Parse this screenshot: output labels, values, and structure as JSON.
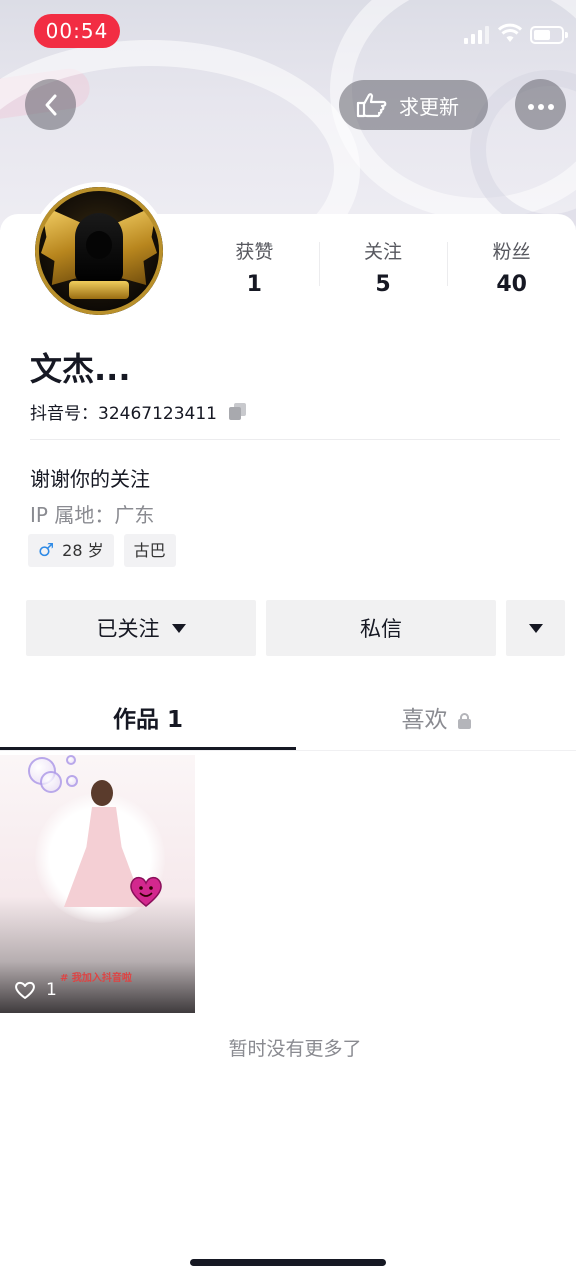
{
  "status_bar": {
    "time": "00:54"
  },
  "nav": {
    "update_button_label": "求更新"
  },
  "profile": {
    "name": "文杰...",
    "douyin_id": "抖音号：32467123411",
    "bio": "谢谢你的关注",
    "ip_location": "IP 属地：广东",
    "tags": {
      "age": "28 岁",
      "location": "古巴"
    }
  },
  "stats": [
    {
      "label": "获赞",
      "value": "1"
    },
    {
      "label": "关注",
      "value": "5"
    },
    {
      "label": "粉丝",
      "value": "40"
    }
  ],
  "actions": {
    "follow_label": "已关注",
    "message_label": "私信"
  },
  "tabs": [
    {
      "label": "作品 1",
      "active": true
    },
    {
      "label": "喜欢",
      "active": false,
      "locked": true
    }
  ],
  "videos": [
    {
      "likes": "1",
      "hashtag": "# 我加入抖音啦"
    }
  ],
  "footer": {
    "no_more_text": "暂时没有更多了"
  },
  "icons": {
    "back": "chevron-left-icon",
    "update": "hand-point-icon",
    "more": "ellipsis-icon",
    "copy": "copy-icon",
    "lock": "lock-icon",
    "like": "heart-outline-icon",
    "gender": "male-icon"
  },
  "colors": {
    "record_pill": "#f22d43",
    "gender_icon": "#2e8ae6",
    "muted_text": "#8a8b91",
    "button_bg": "#f1f1f2"
  }
}
